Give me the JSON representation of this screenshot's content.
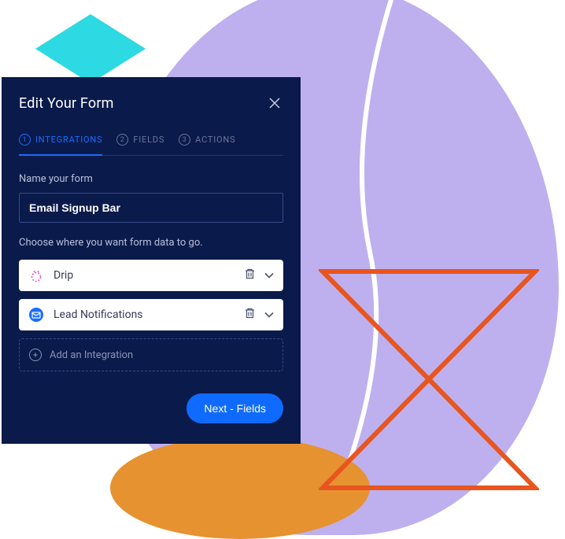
{
  "modal": {
    "title": "Edit Your Form",
    "tabs": [
      {
        "num": "1",
        "label": "INTEGRATIONS",
        "active": true
      },
      {
        "num": "2",
        "label": "FIELDS",
        "active": false
      },
      {
        "num": "3",
        "label": "ACTIONS",
        "active": false
      }
    ],
    "name_label": "Name your form",
    "name_value": "Email Signup Bar",
    "choose_text": "Choose where you want form data to go.",
    "integrations": [
      {
        "icon": "drip-icon",
        "label": "Drip"
      },
      {
        "icon": "mail-icon",
        "label": "Lead Notifications"
      }
    ],
    "add_label": "Add an Integration",
    "next_label": "Next - Fields"
  }
}
